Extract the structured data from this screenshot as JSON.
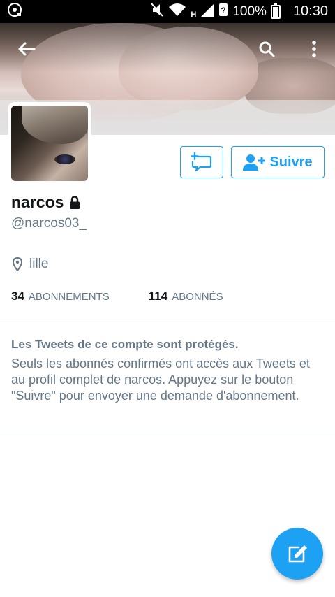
{
  "status_bar": {
    "network_type": "H",
    "battery_percent": "100%",
    "time": "10:30",
    "icons": [
      "notification-icon",
      "mute-icon",
      "wifi-icon",
      "signal-icon",
      "no-sim-icon",
      "battery-icon"
    ]
  },
  "header": {
    "back_icon": "arrow-left-icon",
    "search_icon": "search-icon",
    "more_icon": "more-vertical-icon"
  },
  "profile": {
    "name": "narcos",
    "protected_icon": "lock-icon",
    "handle": "@narcos03_",
    "location": "lille",
    "following_count": "34",
    "following_label": "ABONNEMENTS",
    "followers_count": "114",
    "followers_label": "ABONNÉS"
  },
  "actions": {
    "message_icon": "add-message-icon",
    "follow_label": "Suivre",
    "follow_icon": "add-user-icon"
  },
  "protected_notice": {
    "title": "Les Tweets de ce compte sont protégés.",
    "body": "Seuls les abonnés confirmés ont accès aux Tweets et au profil complet de narcos. Appuyez sur le bouton \"Suivre\" pour envoyer une demande d'abonnement."
  },
  "fab": {
    "icon": "compose-tweet-icon"
  },
  "colors": {
    "accent": "#1da1f2",
    "text": "#14171a",
    "secondary": "#657786"
  }
}
